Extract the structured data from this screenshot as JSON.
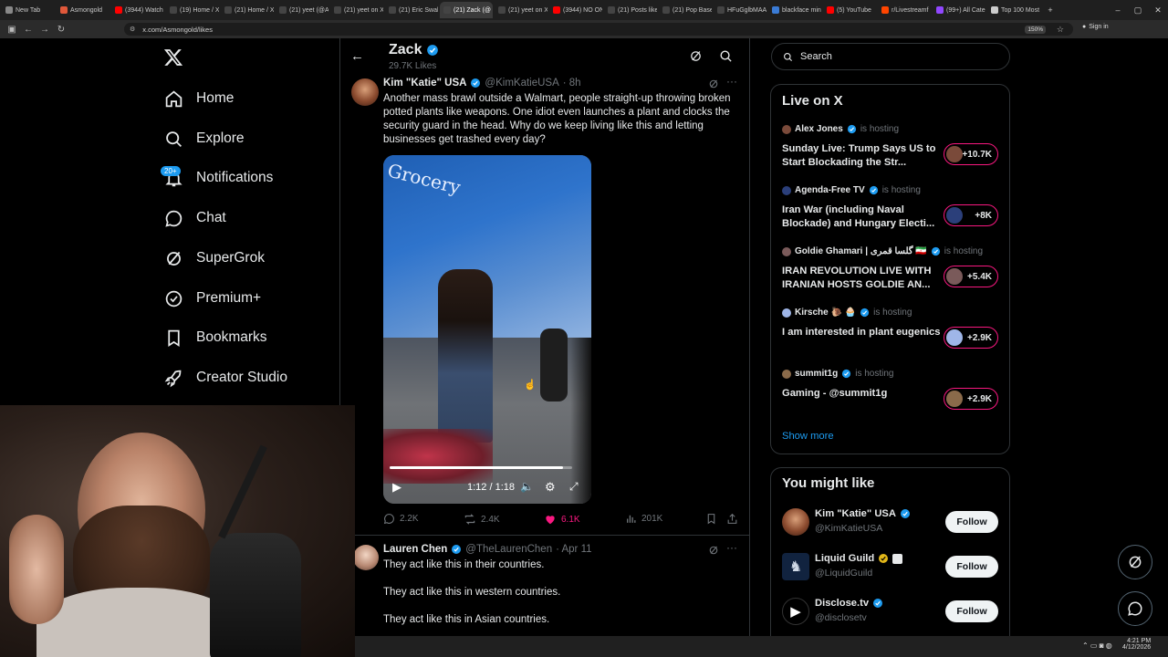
{
  "browser": {
    "tabs": [
      {
        "label": "New Tab",
        "color": "#888888"
      },
      {
        "label": "Asmongold",
        "color": "#e0583a"
      },
      {
        "label": "(3944) Watch",
        "color": "#ff0000"
      },
      {
        "label": "(19) Home / X",
        "color": "#444444"
      },
      {
        "label": "(21) Home / X",
        "color": "#444444"
      },
      {
        "label": "(21) yeet (@A",
        "color": "#444444"
      },
      {
        "label": "(21) yeet on X",
        "color": "#444444"
      },
      {
        "label": "(21) Eric Swal",
        "color": "#444444"
      },
      {
        "label": "(21) Zack (@",
        "color": "#444444",
        "active": true
      },
      {
        "label": "(21) yeet on X",
        "color": "#444444"
      },
      {
        "label": "(3944) NO ON",
        "color": "#ff0000"
      },
      {
        "label": "(21) Posts like",
        "color": "#444444"
      },
      {
        "label": "(21) Pop Base",
        "color": "#444444"
      },
      {
        "label": "HFuGglbMAA",
        "color": "#444444"
      },
      {
        "label": "blackface mini",
        "color": "#3a7bd5"
      },
      {
        "label": "(5) YouTube",
        "color": "#ff0000"
      },
      {
        "label": "r/Livestreamf",
        "color": "#ff4500"
      },
      {
        "label": "(99+) All Cate",
        "color": "#9147ff"
      },
      {
        "label": "Top 100 Most",
        "color": "#cccccc"
      }
    ],
    "url": "x.com/Asmongold/likes",
    "zoom": "150%",
    "sign_in": "Sign in"
  },
  "nav": {
    "home": "Home",
    "explore": "Explore",
    "notifications": "Notifications",
    "notif_count": "20+",
    "chat": "Chat",
    "supergrok": "SuperGrok",
    "premium": "Premium+",
    "bookmarks": "Bookmarks",
    "creator": "Creator Studio"
  },
  "header": {
    "title": "Zack",
    "subtitle": "29.7K Likes"
  },
  "post1": {
    "name": "Kim \"Katie\" USA",
    "handle": "@KimKatieUSA",
    "time": "· 8h",
    "text": "Another mass brawl outside a Walmart, people straight-up throwing broken potted plants like weapons. One idiot even launches a plant and clocks the security guard in the head. Why do we keep living like this and letting businesses get trashed every day?",
    "video_sign": "Grocery",
    "video_time": "1:12 / 1:18",
    "video_progress": 0.95,
    "replies": "2.2K",
    "reposts": "2.4K",
    "likes": "6.1K",
    "views": "201K"
  },
  "post2": {
    "name": "Lauren Chen",
    "handle": "@TheLaurenChen",
    "time": "· Apr 11",
    "line1": "They act like this in their countries.",
    "line2": "They act like this in western countries.",
    "line3": "They act like this in Asian countries."
  },
  "search": {
    "placeholder": "Search"
  },
  "live": {
    "title": "Live on X",
    "hosting": "is hosting",
    "items": [
      {
        "host": "Alex Jones",
        "title": "Sunday Live: Trump Says US to Start Blockading the Str...",
        "count": "+10.7K"
      },
      {
        "host": "Agenda-Free TV",
        "title": "Iran War (including Naval Blockade) and Hungary Electi...",
        "count": "+8K"
      },
      {
        "host": "Goldie Ghamari | گلسا قمری 🇮🇷",
        "title": "IRAN REVOLUTION LIVE WITH IRANIAN HOSTS GOLDIE AN...",
        "count": "+5.4K"
      },
      {
        "host": "Kirsche 🐌 🧁",
        "title": "I am interested in plant eugenics",
        "count": "+2.9K"
      },
      {
        "host": "summit1g",
        "title": "Gaming - @summit1g",
        "count": "+2.9K"
      }
    ],
    "show_more": "Show more"
  },
  "suggest": {
    "title": "You might like",
    "follow": "Follow",
    "items": [
      {
        "name": "Kim \"Katie\" USA",
        "handle": "@KimKatieUSA"
      },
      {
        "name": "Liquid Guild",
        "handle": "@LiquidGuild"
      },
      {
        "name": "Disclose.tv",
        "handle": "@disclosetv"
      }
    ]
  },
  "taskbar": {
    "time": "4:21 PM",
    "date": "4/12/2026"
  },
  "colors": {
    "accent": "#1d9bf0",
    "like": "#f91880",
    "background": "#000000",
    "muted": "#71767b"
  }
}
